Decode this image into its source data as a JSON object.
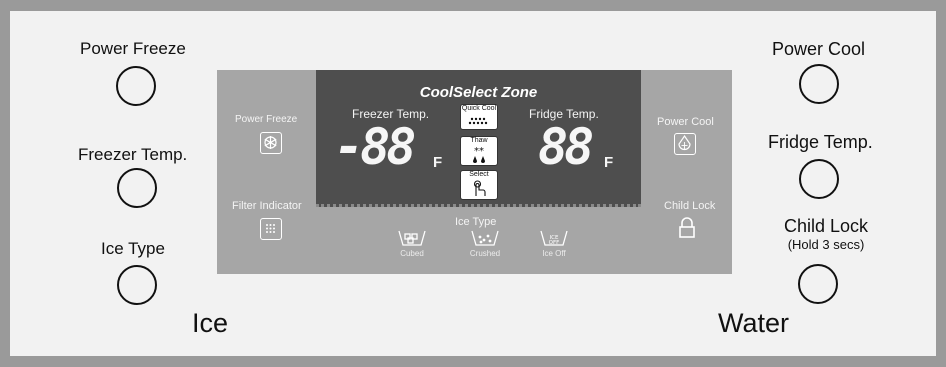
{
  "left_buttons": [
    {
      "label": "Power Freeze"
    },
    {
      "label": "Freezer Temp."
    },
    {
      "label": "Ice Type"
    }
  ],
  "right_buttons": [
    {
      "label": "Power Cool"
    },
    {
      "label": "Fridge Temp."
    },
    {
      "label": "Child Lock",
      "sublabel": "(Hold 3 secs)"
    }
  ],
  "section_labels": {
    "left": "Ice",
    "right": "Water"
  },
  "display": {
    "title": "CoolSelect Zone",
    "freezer_label": "Freezer Temp.",
    "fridge_label": "Fridge Temp.",
    "freezer_value": "-88",
    "fridge_value": "88",
    "unit": "F",
    "center_buttons": [
      "Quick Cool",
      "Thaw",
      "Select"
    ],
    "left_indicators": [
      "Power Freeze",
      "Filter Indicator"
    ],
    "right_indicators": [
      "Power Cool",
      "Child Lock"
    ],
    "ice_type_label": "Ice Type",
    "ice_options": [
      "Cubed",
      "Crushed",
      "Ice Off"
    ]
  },
  "colors": {
    "frame": "#9a9a9a",
    "panel": "#f2f2f2",
    "display": "#a6a6a6",
    "lcd": "#4e4e4e"
  }
}
